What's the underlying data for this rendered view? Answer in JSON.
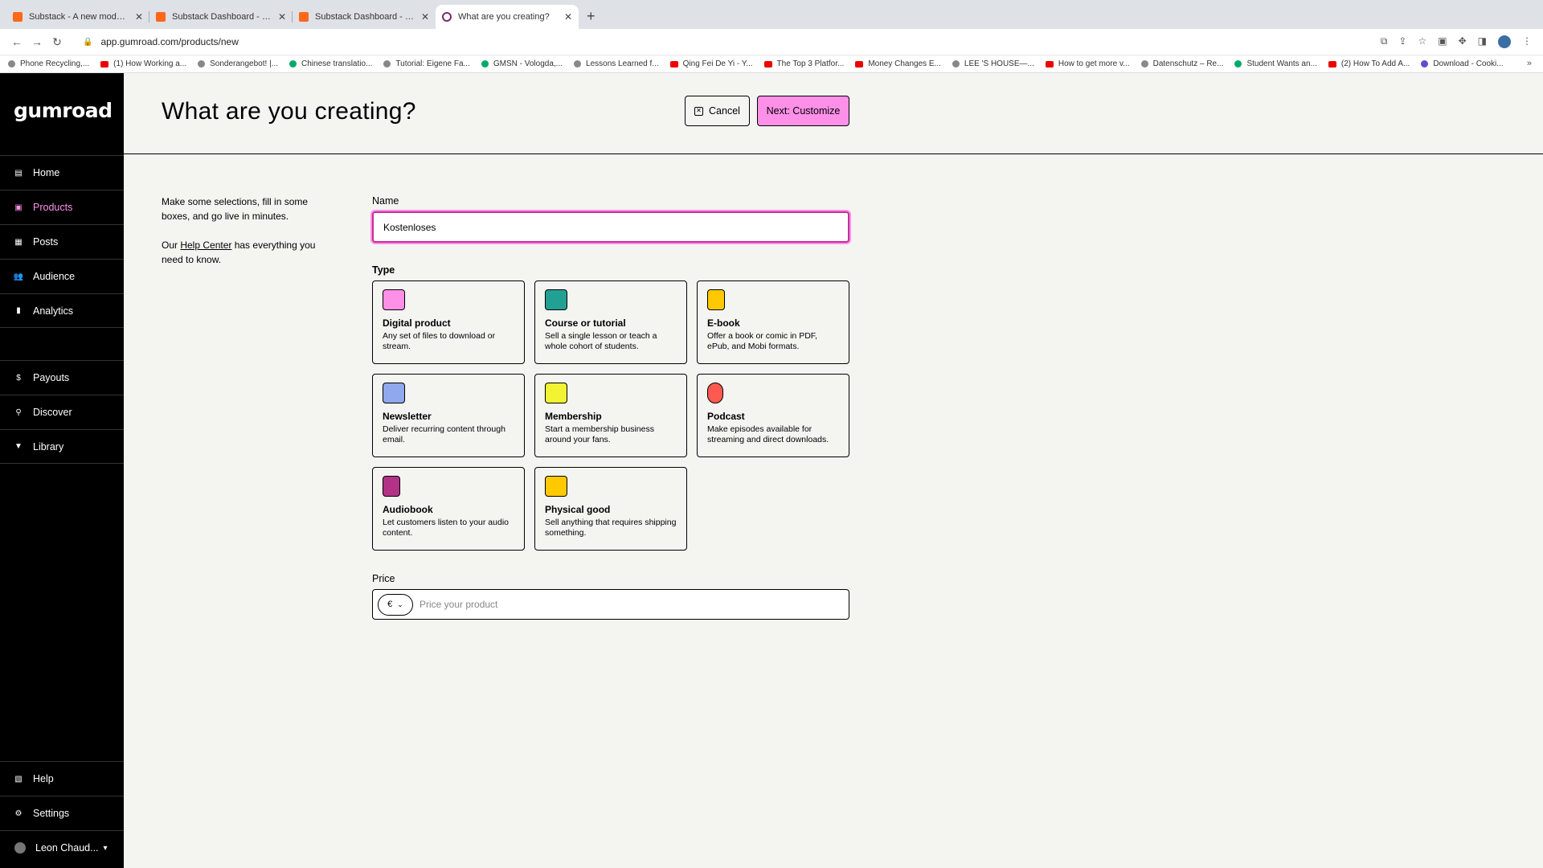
{
  "browser": {
    "tabs": [
      {
        "title": "Substack - A new model for pu",
        "favicon": "substack-icon",
        "active": false
      },
      {
        "title": "Substack Dashboard - Leon's",
        "favicon": "substack-icon",
        "active": false
      },
      {
        "title": "Substack Dashboard - Leon's",
        "favicon": "substack-icon",
        "active": false
      },
      {
        "title": "What are you creating?",
        "favicon": "gumroad-icon",
        "active": true
      }
    ],
    "new_tab": "+",
    "url": "app.gumroad.com/products/new",
    "bookmarks": [
      "Phone Recycling,...",
      "(1) How Working a...",
      "Sonderangebot! |...",
      "Chinese translatio...",
      "Tutorial: Eigene Fa...",
      "GMSN - Vologda,...",
      "Lessons Learned f...",
      "Qing Fei De Yi - Y...",
      "The Top 3 Platfor...",
      "Money Changes E...",
      "LEE 'S HOUSE—...",
      "How to get more v...",
      "Datenschutz – Re...",
      "Student Wants an...",
      "(2) How To Add A...",
      "Download - Cooki..."
    ],
    "bookmarks_more": "»"
  },
  "sidebar": {
    "logo": "gumroad",
    "items": [
      {
        "label": "Home",
        "icon": "home-icon"
      },
      {
        "label": "Products",
        "icon": "products-icon",
        "active": true
      },
      {
        "label": "Posts",
        "icon": "posts-icon"
      },
      {
        "label": "Audience",
        "icon": "audience-icon"
      },
      {
        "label": "Analytics",
        "icon": "analytics-icon"
      },
      {
        "label": "Payouts",
        "icon": "payouts-icon"
      },
      {
        "label": "Discover",
        "icon": "search-icon"
      },
      {
        "label": "Library",
        "icon": "bookmark-icon"
      }
    ],
    "bottom": [
      {
        "label": "Help",
        "icon": "help-icon"
      },
      {
        "label": "Settings",
        "icon": "gear-icon"
      }
    ],
    "user": "Leon Chaud..."
  },
  "header": {
    "title": "What are you creating?",
    "cancel_label": "Cancel",
    "next_label": "Next: Customize"
  },
  "intro": {
    "line1": "Make some selections, fill in some boxes, and go live in minutes.",
    "pre_link": "Our ",
    "link": "Help Center",
    "post_link": " has everything you need to know."
  },
  "form": {
    "name_label": "Name",
    "name_value": "Kostenloses",
    "type_label": "Type",
    "types": [
      {
        "title": "Digital product",
        "desc": "Any set of files to download or stream.",
        "color": "#ff90e8",
        "icon": "digital-product-icon"
      },
      {
        "title": "Course or tutorial",
        "desc": "Sell a single lesson or teach a whole cohort of students.",
        "color": "#23a094",
        "icon": "course-icon"
      },
      {
        "title": "E-book",
        "desc": "Offer a book or comic in PDF, ePub, and Mobi formats.",
        "color": "#ffc900",
        "icon": "ebook-icon"
      },
      {
        "title": "Newsletter",
        "desc": "Deliver recurring content through email.",
        "color": "#90a8ed",
        "icon": "newsletter-icon"
      },
      {
        "title": "Membership",
        "desc": "Start a membership business around your fans.",
        "color": "#f1f333",
        "icon": "membership-icon"
      },
      {
        "title": "Podcast",
        "desc": "Make episodes available for streaming and direct downloads.",
        "color": "#ff5a50",
        "icon": "podcast-icon"
      },
      {
        "title": "Audiobook",
        "desc": "Let customers listen to your audio content.",
        "color": "#b23386",
        "icon": "audiobook-icon"
      },
      {
        "title": "Physical good",
        "desc": "Sell anything that requires shipping something.",
        "color": "#ffc900",
        "icon": "physical-good-icon"
      }
    ],
    "price_label": "Price",
    "currency": "€",
    "price_placeholder": "Price your product"
  }
}
